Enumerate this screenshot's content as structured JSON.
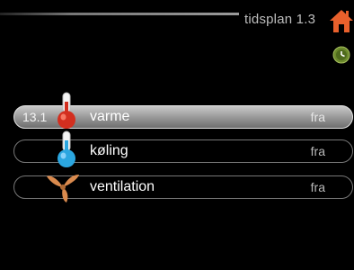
{
  "header": {
    "title": "tidsplan 1.3",
    "home_icon": "home-icon",
    "clock_icon": "clock-icon",
    "accent": "#e8602c"
  },
  "menu": {
    "items": [
      {
        "number": "13.1",
        "label": "varme",
        "value": "fra",
        "icon": "thermometer-red-icon",
        "selected": true
      },
      {
        "number": "",
        "label": "køling",
        "value": "fra",
        "icon": "thermometer-blue-icon",
        "selected": false
      },
      {
        "number": "",
        "label": "ventilation",
        "value": "fra",
        "icon": "fan-icon",
        "selected": false
      }
    ]
  }
}
